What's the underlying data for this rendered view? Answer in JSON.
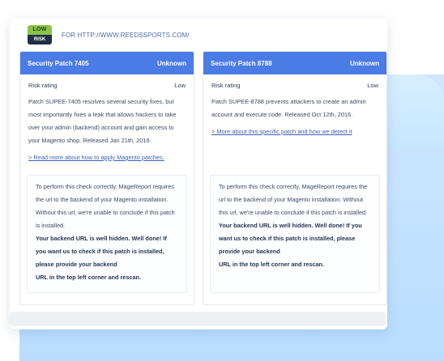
{
  "header": {
    "badge_top": "LOW",
    "badge_bottom": "RISK",
    "for_url": "FOR HTTP://WWW.REEDSSPORTS.COM/"
  },
  "patches": [
    {
      "title": "Security Patch 7405",
      "status": "Unknown",
      "risk_label": "Risk rating",
      "risk_value": "Low",
      "description": "Patch SUPEE-7405 resolves several security fixes, but most importantly fixes a leak that allows hackers to take over your admin (backend) account and gain access to your Magento shop. Released Jan 21th, 2016.",
      "link": "> Read more about how to apply Magento  patches.",
      "note_plain": "To perform this check correctly, MageReport requires the url to the backend of your Magento installation. Without this url, we're unable to conclude if this patch is installed.",
      "note_bold_1": "Your backend URL is well hidden. Well done! If you want us to check if this patch is installed, please provide your backend",
      "note_bold_2": "URL in the top left corner and rescan."
    },
    {
      "title": "Security Patch 8788",
      "status": "Unknown",
      "risk_label": "Risk rating",
      "risk_value": "Low",
      "description": "Patch SUPEE-8788 prevents attackers to create an admin account and execute code. Released Oct 12th, 2016.",
      "link": "> More about this specific patch and how we detect it",
      "note_plain": "To perform this check correctly, MageReport requires the url to the backend of your Magento installation. Without this url, we're unable to conclude if this patch is installed.",
      "note_bold_1": "Your backend URL is well hidden. Well done! If you want us to check if this patch is installed, please provide your backend",
      "note_bold_2": "URL in the top left corner and rescan."
    }
  ]
}
